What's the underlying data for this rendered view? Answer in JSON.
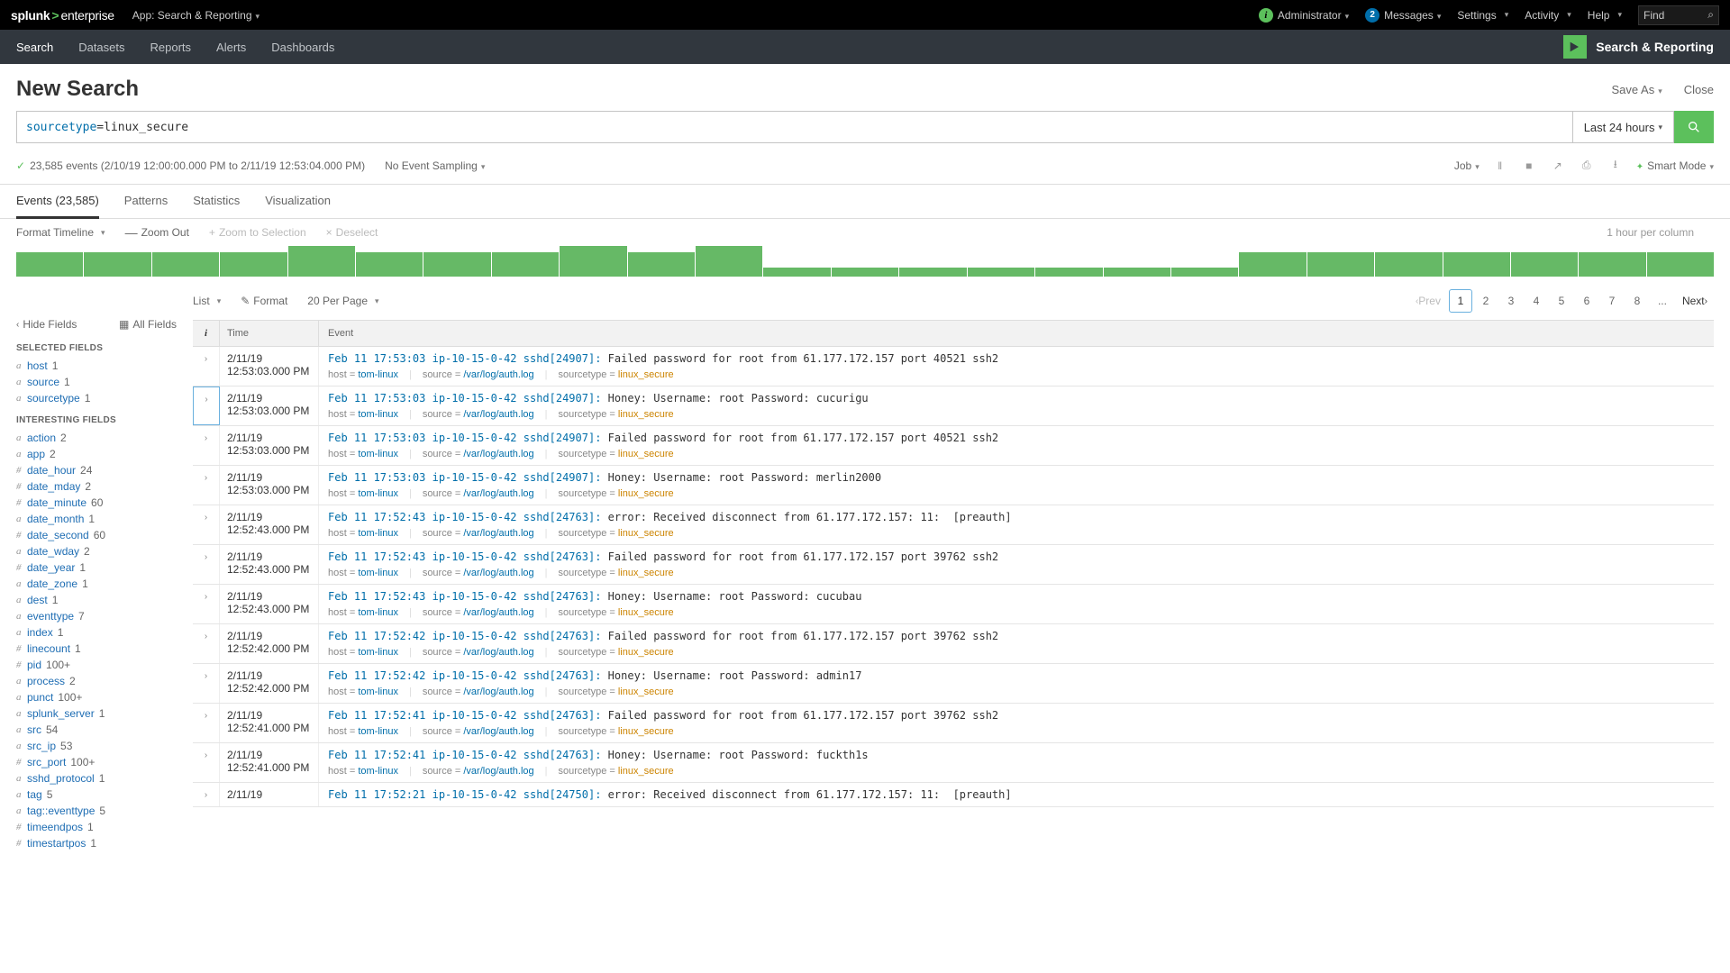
{
  "topbar": {
    "logo1": "splunk",
    "logo2": "enterprise",
    "app_context": "App: Search & Reporting",
    "admin": "Administrator",
    "messages_count": "2",
    "messages": "Messages",
    "settings": "Settings",
    "activity": "Activity",
    "help": "Help",
    "find": "Find"
  },
  "nav": {
    "items": [
      {
        "label": "Search",
        "active": true
      },
      {
        "label": "Datasets"
      },
      {
        "label": "Reports"
      },
      {
        "label": "Alerts"
      },
      {
        "label": "Dashboards"
      }
    ],
    "brand": "Search & Reporting"
  },
  "page": {
    "title": "New Search",
    "save_as": "Save As",
    "close": "Close"
  },
  "search": {
    "query_key": "sourcetype",
    "query_eq": "=linux_secure",
    "timerange": "Last 24 hours"
  },
  "status": {
    "count_text": "23,585 events (2/10/19 12:00:00.000 PM to 2/11/19 12:53:04.000 PM)",
    "sampling": "No Event Sampling",
    "job": "Job",
    "smart": "Smart Mode"
  },
  "tabs": {
    "events": "Events (23,585)",
    "patterns": "Patterns",
    "statistics": "Statistics",
    "visualization": "Visualization"
  },
  "timeline": {
    "format": "Format Timeline",
    "zoom_out": "Zoom Out",
    "zoom_sel": "Zoom to Selection",
    "deselect": "Deselect",
    "per_column": "1 hour per column",
    "bars": [
      80,
      80,
      80,
      80,
      100,
      80,
      80,
      80,
      100,
      80,
      100,
      30,
      30,
      30,
      30,
      30,
      30,
      30,
      80,
      80,
      80,
      80,
      80,
      80,
      80
    ]
  },
  "sidebar": {
    "hide_fields": "Hide Fields",
    "all_fields": "All Fields",
    "selected_title": "SELECTED FIELDS",
    "interesting_title": "INTERESTING FIELDS",
    "selected": [
      {
        "t": "a",
        "name": "host",
        "count": "1"
      },
      {
        "t": "a",
        "name": "source",
        "count": "1"
      },
      {
        "t": "a",
        "name": "sourcetype",
        "count": "1"
      }
    ],
    "interesting": [
      {
        "t": "a",
        "name": "action",
        "count": "2"
      },
      {
        "t": "a",
        "name": "app",
        "count": "2"
      },
      {
        "t": "#",
        "name": "date_hour",
        "count": "24"
      },
      {
        "t": "#",
        "name": "date_mday",
        "count": "2"
      },
      {
        "t": "#",
        "name": "date_minute",
        "count": "60"
      },
      {
        "t": "a",
        "name": "date_month",
        "count": "1"
      },
      {
        "t": "#",
        "name": "date_second",
        "count": "60"
      },
      {
        "t": "a",
        "name": "date_wday",
        "count": "2"
      },
      {
        "t": "#",
        "name": "date_year",
        "count": "1"
      },
      {
        "t": "a",
        "name": "date_zone",
        "count": "1"
      },
      {
        "t": "a",
        "name": "dest",
        "count": "1"
      },
      {
        "t": "a",
        "name": "eventtype",
        "count": "7"
      },
      {
        "t": "a",
        "name": "index",
        "count": "1"
      },
      {
        "t": "#",
        "name": "linecount",
        "count": "1"
      },
      {
        "t": "#",
        "name": "pid",
        "count": "100+"
      },
      {
        "t": "a",
        "name": "process",
        "count": "2"
      },
      {
        "t": "a",
        "name": "punct",
        "count": "100+"
      },
      {
        "t": "a",
        "name": "splunk_server",
        "count": "1"
      },
      {
        "t": "a",
        "name": "src",
        "count": "54"
      },
      {
        "t": "a",
        "name": "src_ip",
        "count": "53"
      },
      {
        "t": "#",
        "name": "src_port",
        "count": "100+"
      },
      {
        "t": "a",
        "name": "sshd_protocol",
        "count": "1"
      },
      {
        "t": "a",
        "name": "tag",
        "count": "5"
      },
      {
        "t": "a",
        "name": "tag::eventtype",
        "count": "5"
      },
      {
        "t": "#",
        "name": "timeendpos",
        "count": "1"
      },
      {
        "t": "#",
        "name": "timestartpos",
        "count": "1"
      }
    ]
  },
  "events_ctl": {
    "list": "List",
    "format": "Format",
    "per_page": "20 Per Page",
    "prev": "Prev",
    "next": "Next",
    "pages": [
      "1",
      "2",
      "3",
      "4",
      "5",
      "6",
      "7",
      "8",
      "..."
    ]
  },
  "events_header": {
    "i": "i",
    "time": "Time",
    "event": "Event"
  },
  "meta_labels": {
    "host": "host",
    "source": "source",
    "sourcetype": "sourcetype"
  },
  "meta_common": {
    "host": "tom-linux",
    "source": "/var/log/auth.log",
    "sourcetype": "linux_secure"
  },
  "events": [
    {
      "date": "2/11/19",
      "time": "12:53:03.000 PM",
      "pre": "Feb 11 17:53:03 ip-10-15-0-42 sshd[24907]: ",
      "body": "Failed password for root from 61.177.172.157 port 40521 ssh2"
    },
    {
      "date": "2/11/19",
      "time": "12:53:03.000 PM",
      "pre": "Feb 11 17:53:03 ip-10-15-0-42 sshd[24907]: ",
      "body": "Honey: Username: root Password: cucurigu",
      "selected": true
    },
    {
      "date": "2/11/19",
      "time": "12:53:03.000 PM",
      "pre": "Feb 11 17:53:03 ip-10-15-0-42 sshd[24907]: ",
      "body": "Failed password for root from 61.177.172.157 port 40521 ssh2"
    },
    {
      "date": "2/11/19",
      "time": "12:53:03.000 PM",
      "pre": "Feb 11 17:53:03 ip-10-15-0-42 sshd[24907]: ",
      "body": "Honey: Username: root Password: merlin2000"
    },
    {
      "date": "2/11/19",
      "time": "12:52:43.000 PM",
      "pre": "Feb 11 17:52:43 ip-10-15-0-42 sshd[24763]: ",
      "body": "error: Received disconnect from 61.177.172.157: 11:  [preauth]"
    },
    {
      "date": "2/11/19",
      "time": "12:52:43.000 PM",
      "pre": "Feb 11 17:52:43 ip-10-15-0-42 sshd[24763]: ",
      "body": "Failed password for root from 61.177.172.157 port 39762 ssh2"
    },
    {
      "date": "2/11/19",
      "time": "12:52:43.000 PM",
      "pre": "Feb 11 17:52:43 ip-10-15-0-42 sshd[24763]: ",
      "body": "Honey: Username: root Password: cucubau"
    },
    {
      "date": "2/11/19",
      "time": "12:52:42.000 PM",
      "pre": "Feb 11 17:52:42 ip-10-15-0-42 sshd[24763]: ",
      "body": "Failed password for root from 61.177.172.157 port 39762 ssh2"
    },
    {
      "date": "2/11/19",
      "time": "12:52:42.000 PM",
      "pre": "Feb 11 17:52:42 ip-10-15-0-42 sshd[24763]: ",
      "body": "Honey: Username: root Password: admin17"
    },
    {
      "date": "2/11/19",
      "time": "12:52:41.000 PM",
      "pre": "Feb 11 17:52:41 ip-10-15-0-42 sshd[24763]: ",
      "body": "Failed password for root from 61.177.172.157 port 39762 ssh2"
    },
    {
      "date": "2/11/19",
      "time": "12:52:41.000 PM",
      "pre": "Feb 11 17:52:41 ip-10-15-0-42 sshd[24763]: ",
      "body": "Honey: Username: root Password: fuckth1s"
    },
    {
      "date": "2/11/19",
      "time": "",
      "pre": "Feb 11 17:52:21 ip-10-15-0-42 sshd[24750]: ",
      "body": "error: Received disconnect from 61.177.172.157: 11:  [preauth]",
      "nometa": true
    }
  ]
}
